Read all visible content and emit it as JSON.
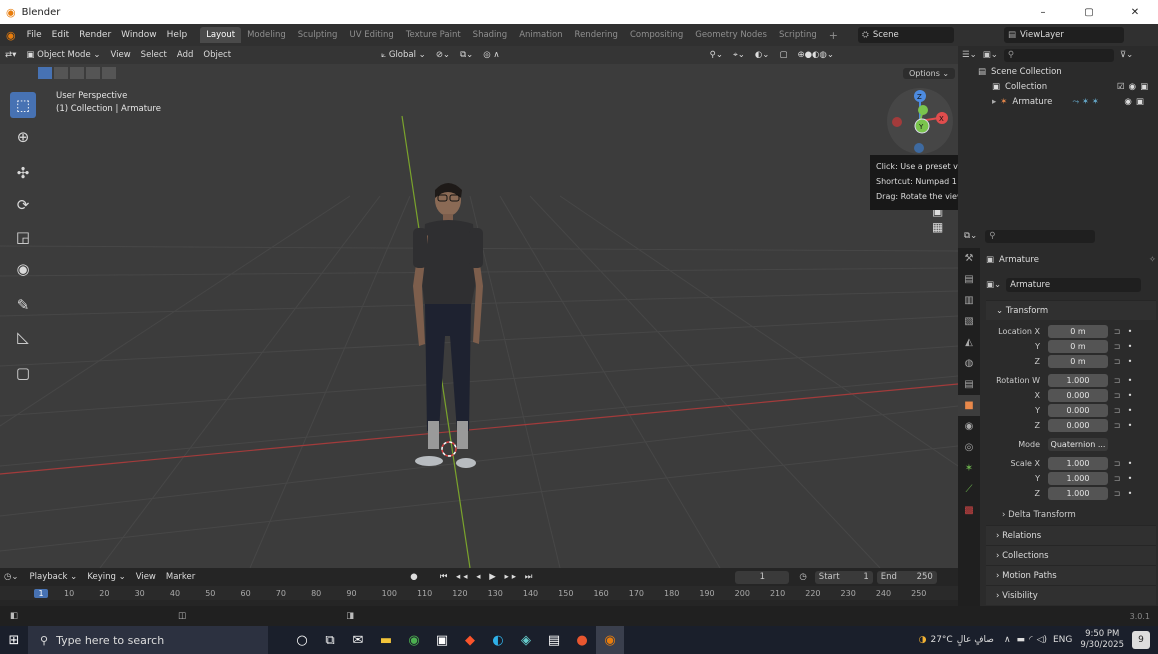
{
  "app": {
    "title": "Blender"
  },
  "window_controls": {
    "minimize": "–",
    "maximize": "▢",
    "close": "✕"
  },
  "menu": [
    "File",
    "Edit",
    "Render",
    "Window",
    "Help"
  ],
  "workspaces": [
    "Layout",
    "Modeling",
    "Sculpting",
    "UV Editing",
    "Texture Paint",
    "Shading",
    "Animation",
    "Rendering",
    "Compositing",
    "Geometry Nodes",
    "Scripting"
  ],
  "workspace_add": "+",
  "scene": {
    "label": "Scene",
    "view_layer": "ViewLayer"
  },
  "viewport_header": {
    "mode": "Object Mode",
    "items": [
      "View",
      "Select",
      "Add",
      "Object"
    ],
    "transform": "Global",
    "options": "Options"
  },
  "viewport_info": {
    "line1": "User Perspective",
    "line2": "(1) Collection | Armature"
  },
  "gizmo": {
    "z": "Z",
    "y": "Y",
    "x": "X"
  },
  "tooltip": {
    "line1": "Click: Use a preset viewpoint",
    "line2": "Shortcut: Numpad 1",
    "line3": "Drag: Rotate the view"
  },
  "outliner": {
    "root": "Scene Collection",
    "items": [
      {
        "label": "Collection"
      },
      {
        "label": "Armature"
      }
    ]
  },
  "properties": {
    "object_name": "Armature",
    "object_field": "Armature",
    "transform_header": "Transform",
    "location": {
      "label": "Location X",
      "x": "0 m",
      "y": "0 m",
      "z": "0 m"
    },
    "rotation": {
      "label": "Rotation W",
      "w": "1.000",
      "x": "0.000",
      "y": "0.000",
      "z": "0.000"
    },
    "mode": {
      "label": "Mode",
      "value": "Quaternion ..."
    },
    "scale": {
      "label": "Scale X",
      "x": "1.000",
      "y": "1.000",
      "z": "1.000"
    },
    "axis": {
      "y": "Y",
      "z": "Z",
      "x": "X"
    },
    "sections": [
      "Delta Transform",
      "Relations",
      "Collections",
      "Motion Paths",
      "Visibility"
    ]
  },
  "timeline": {
    "menus": [
      "Playback",
      "Keying",
      "View",
      "Marker"
    ],
    "current_frame": "1",
    "start_label": "Start",
    "start": "1",
    "end_label": "End",
    "end": "250",
    "ticks": [
      "1",
      "10",
      "20",
      "30",
      "40",
      "50",
      "60",
      "70",
      "80",
      "90",
      "100",
      "110",
      "120",
      "130",
      "140",
      "150",
      "160",
      "170",
      "180",
      "190",
      "200",
      "210",
      "220",
      "230",
      "240",
      "250"
    ]
  },
  "statusbar": {
    "version": "3.0.1"
  },
  "taskbar": {
    "search_placeholder": "Type here to search",
    "weather": "27°C",
    "weather_text": "صافٍ عالٍ",
    "lang": "ENG",
    "time": "9:50 PM",
    "date": "9/30/2025",
    "notifications": "9"
  },
  "colors": {
    "accent": "#4772b3",
    "x_axis": "#a33b3b",
    "y_axis": "#7aa32c",
    "active_tab": "#e8884a"
  }
}
